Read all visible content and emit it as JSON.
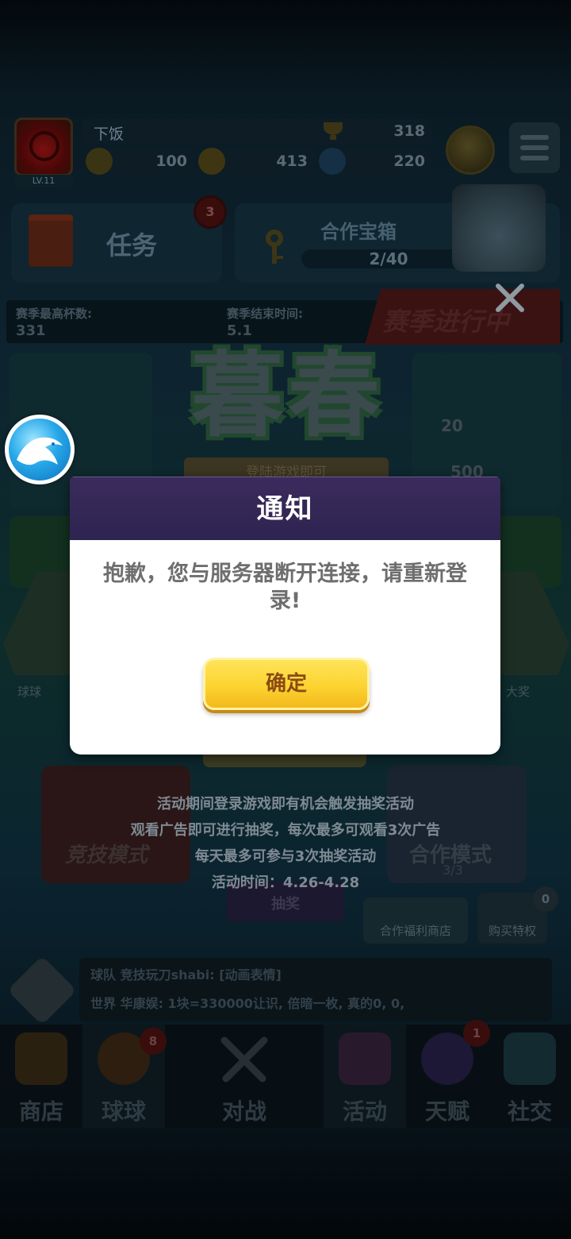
{
  "player": {
    "name": "下饭",
    "level": "LV.11",
    "trophies": "318",
    "gems": "100",
    "coins": "413",
    "crystals": "220"
  },
  "task_panel": {
    "label": "任务",
    "badge": "3"
  },
  "chest_panel": {
    "title": "合作宝箱",
    "progress": "2/40"
  },
  "season": {
    "cups_label": "赛季最高杯数:",
    "cups_value": "331",
    "end_label": "赛季结束时间:",
    "end_value": "5.1",
    "status": "赛季进行中"
  },
  "event_banner": {
    "title": "暮春",
    "sign_text": "登陆游戏即可",
    "reward_top": "20",
    "reward_bottom": "500",
    "side_left": "球球",
    "side_right": "大奖"
  },
  "modal": {
    "title": "通知",
    "message": "抱歉，您与服务器断开连接，请重新登录!",
    "confirm_label": "确定"
  },
  "event_info": {
    "lines": [
      "活动期间登录游戏即有机会触发抽奖活动",
      "观看广告即可进行抽奖，每次最多可观看3次广告",
      "每天最多可参与3次抽奖活动",
      "活动时间：4.26-4.28"
    ],
    "under_modal": "(3/3)",
    "time_box": "抽奖"
  },
  "modes": {
    "left": "竞技模式",
    "right": "合作模式",
    "right_sub": "3/3",
    "shop": "合作福利商店",
    "perk": "购买特权",
    "perk_badge": "0"
  },
  "chat": {
    "line1": "球队  竞技玩刀shabi: [动画表情]",
    "line2": "世界  华康娱: 1块=330000让识, 倍暗一枚, 真的0, 0,"
  },
  "nav": {
    "items": [
      {
        "label": "商店",
        "badge": ""
      },
      {
        "label": "球球",
        "badge": "8"
      },
      {
        "label": "对战",
        "badge": ""
      },
      {
        "label": "活动",
        "badge": ""
      },
      {
        "label": "天赋",
        "badge": "1"
      },
      {
        "label": "社交",
        "badge": ""
      }
    ]
  },
  "colors": {
    "modal_header": "#2e2450",
    "confirm_button": "#fcd431",
    "confirm_text": "#8b4a14",
    "app_icon_blue": "#28a8e8"
  }
}
